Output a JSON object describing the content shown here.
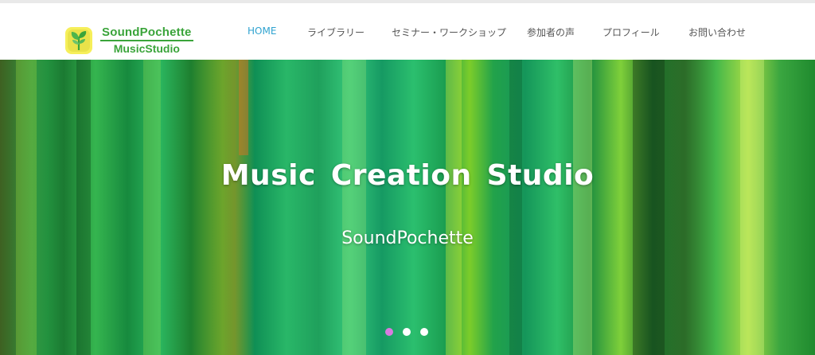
{
  "logo": {
    "line1": "SoundPochette",
    "line2": "MusicStudio",
    "icon": "leaf-sprout-icon",
    "color": "#3aa43a"
  },
  "nav": {
    "items": [
      {
        "label": "HOME",
        "active": true
      },
      {
        "label": "ライブラリー",
        "active": false
      },
      {
        "label": "セミナー・ワークショップ",
        "active": false
      },
      {
        "label": "参加者の声",
        "active": false
      },
      {
        "label": "プロフィール",
        "active": false
      },
      {
        "label": "お問い合わせ",
        "active": false
      }
    ],
    "active_color": "#2fa3d0"
  },
  "hero": {
    "title": "Music  Creation  Studio",
    "subtitle": "SoundPochette",
    "slides": 3,
    "active_slide": 1,
    "dot_active_color": "#d97be0"
  }
}
